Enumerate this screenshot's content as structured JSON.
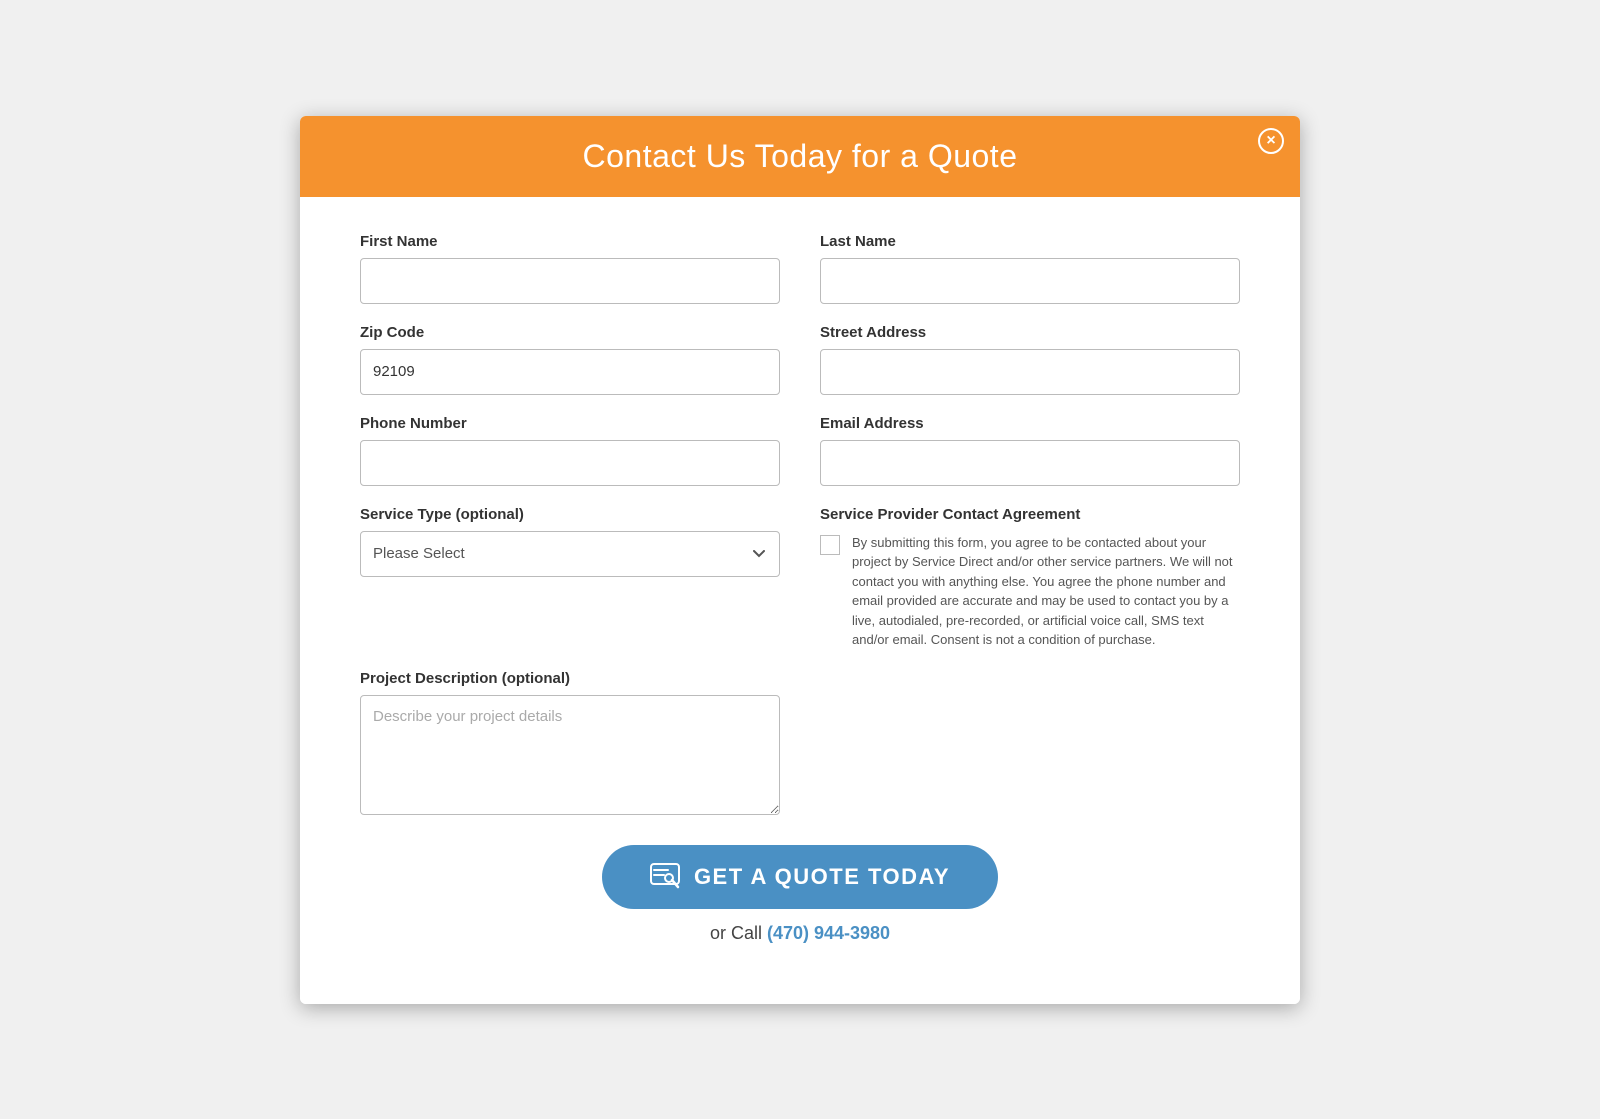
{
  "modal": {
    "header": {
      "title": "Contact Us Today for a Quote",
      "close_label": "×"
    },
    "form": {
      "first_name_label": "First Name",
      "first_name_placeholder": "",
      "first_name_value": "",
      "last_name_label": "Last Name",
      "last_name_placeholder": "",
      "last_name_value": "",
      "zip_code_label": "Zip Code",
      "zip_code_value": "92109",
      "street_address_label": "Street Address",
      "street_address_value": "",
      "phone_number_label": "Phone Number",
      "phone_number_value": "",
      "email_address_label": "Email Address",
      "email_address_value": "",
      "service_type_label": "Service Type (optional)",
      "service_type_placeholder": "Please Select",
      "project_description_label": "Project Description (optional)",
      "project_description_placeholder": "Describe your project details",
      "agreement_title": "Service Provider Contact Agreement",
      "agreement_text": "By submitting this form, you agree to be contacted about your project by Service Direct and/or other service partners. We will not contact you with anything else. You agree the phone number and email provided are accurate and may be used to contact you by a live, autodialed, pre-recorded, or artificial voice call, SMS text and/or email. Consent is not a condition of purchase.",
      "submit_label": "GET A QUOTE TODAY",
      "or_call_text": "or Call",
      "phone_number_display": "(470) 944-3980",
      "phone_href": "tel:4709443980"
    }
  }
}
